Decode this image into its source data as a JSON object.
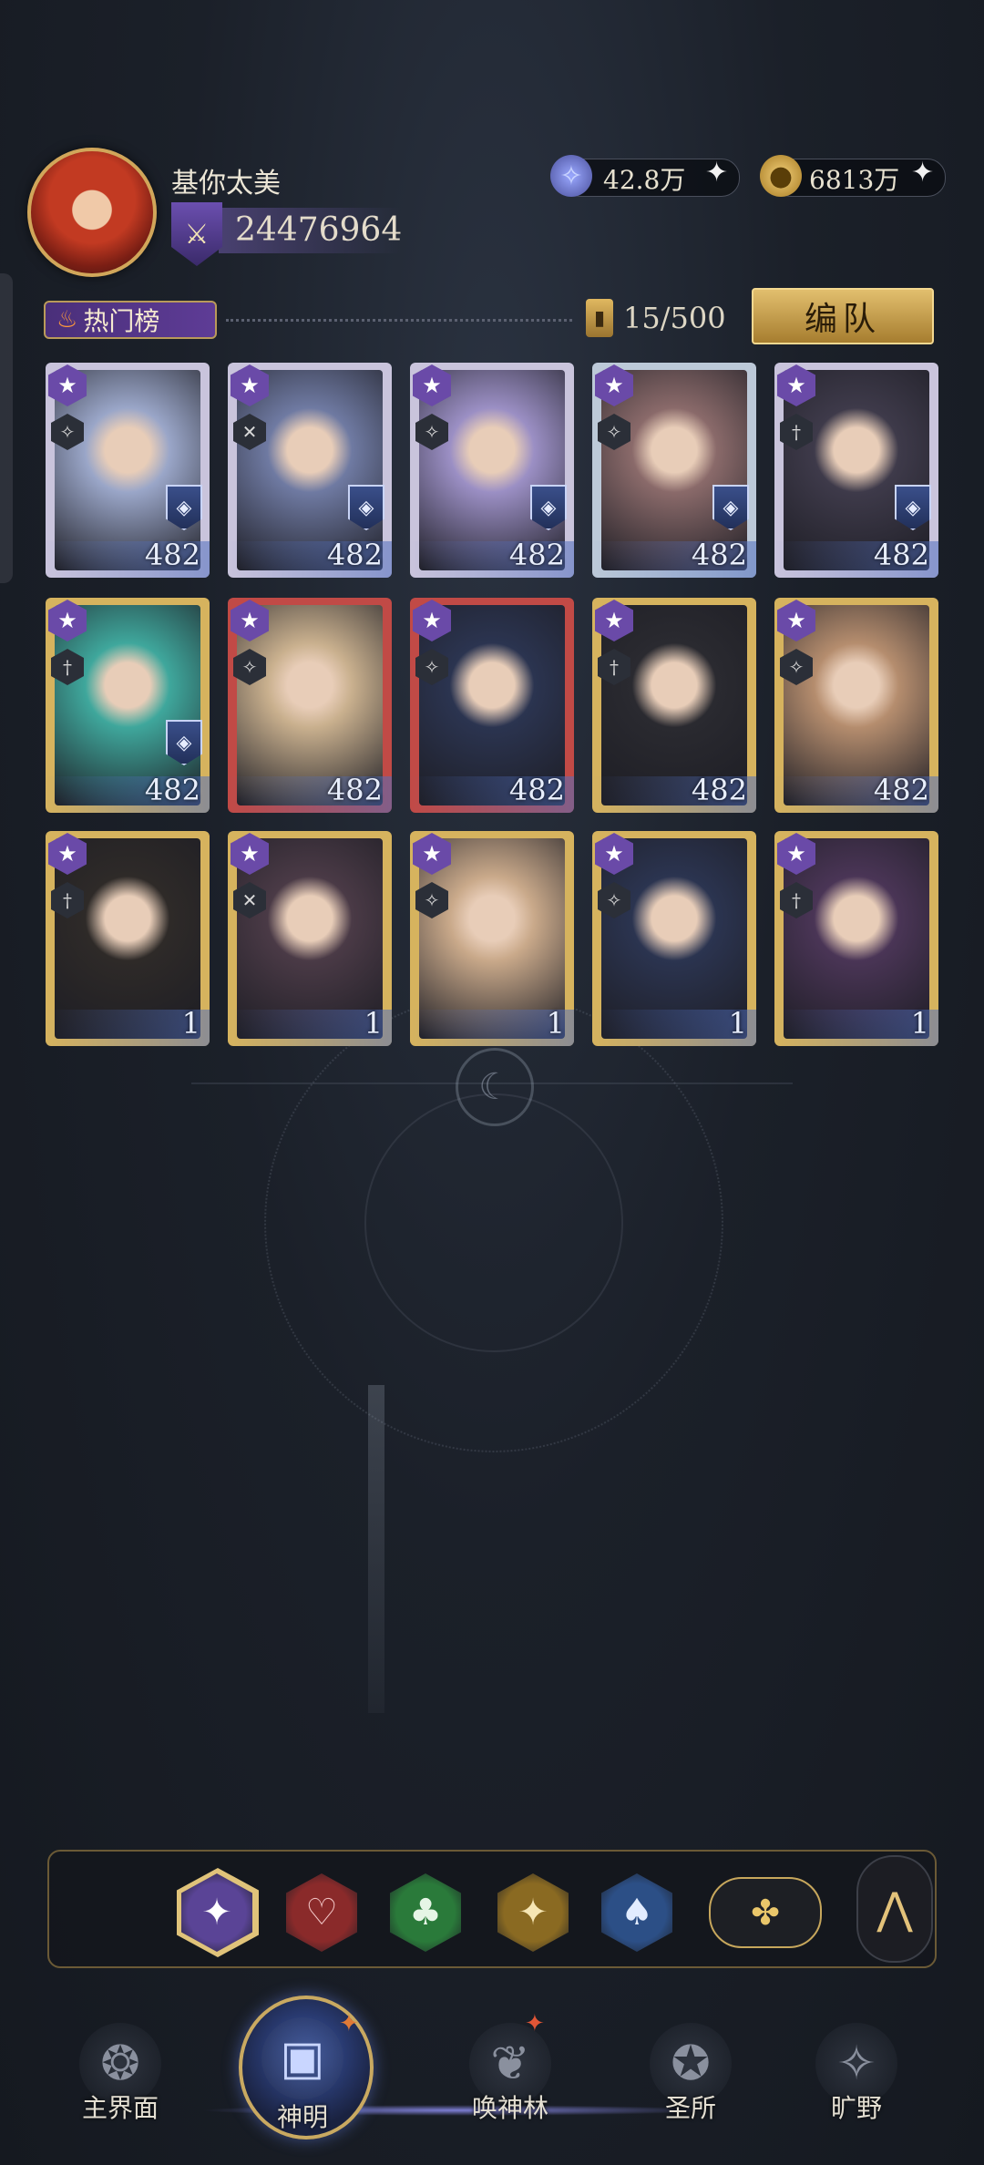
{
  "player": {
    "name": "基你太美",
    "power": "24476964",
    "power_badge_icon": "crossed-swords-icon"
  },
  "resources": [
    {
      "name": "crystal",
      "icon": "crystal-icon",
      "value": "42.8万"
    },
    {
      "name": "gold-coin",
      "icon": "gold-coin-icon",
      "value": "6813万"
    }
  ],
  "ranking": {
    "tab_label": "热门榜",
    "count": "15/500",
    "team_button": "编队"
  },
  "cards": [
    {
      "level": "482",
      "frame": "#c9c4dc",
      "face": "#9aa6c8",
      "emblem": "◈"
    },
    {
      "level": "482",
      "frame": "#c9c4dc",
      "face": "#6f7aa2",
      "emblem": "◈"
    },
    {
      "level": "482",
      "frame": "#c9c4dc",
      "face": "#9b8fc4",
      "emblem": "◈"
    },
    {
      "level": "482",
      "frame": "#bcc9d8",
      "face": "#8a6a6a",
      "emblem": "◈"
    },
    {
      "level": "482",
      "frame": "#c9c4dc",
      "face": "#3e3a4a",
      "emblem": "◈"
    },
    {
      "level": "482",
      "frame": "#d6b35e",
      "face": "#3fa79c",
      "emblem": "◈"
    },
    {
      "level": "482",
      "frame": "#c14a46",
      "face": "#c9b08e",
      "emblem": ""
    },
    {
      "level": "482",
      "frame": "#c14a46",
      "face": "#2b3450",
      "emblem": ""
    },
    {
      "level": "482",
      "frame": "#d6b35e",
      "face": "#2a2a30",
      "emblem": ""
    },
    {
      "level": "482",
      "frame": "#d6b35e",
      "face": "#b58d6e",
      "emblem": ""
    },
    {
      "level": "1",
      "frame": "#d6b35e",
      "face": "#2e2a28",
      "emblem": ""
    },
    {
      "level": "1",
      "frame": "#d6b35e",
      "face": "#4a3a46",
      "emblem": ""
    },
    {
      "level": "1",
      "frame": "#d6b35e",
      "face": "#c9a98a",
      "emblem": ""
    },
    {
      "level": "1",
      "frame": "#d6b35e",
      "face": "#2b3450",
      "emblem": ""
    },
    {
      "level": "1",
      "frame": "#d6b35e",
      "face": "#4a3556",
      "emblem": ""
    }
  ],
  "filters": [
    {
      "name": "all",
      "icon": "star-icon",
      "glyph": "✦",
      "color": "#5a4496",
      "text": "#ffffff"
    },
    {
      "name": "heart",
      "icon": "heart-icon",
      "glyph": "♡",
      "color": "#8a2a2a",
      "text": "#f3c7c7"
    },
    {
      "name": "club",
      "icon": "club-icon",
      "glyph": "♣",
      "color": "#2a7a3a",
      "text": "#e6f5e6"
    },
    {
      "name": "diamond",
      "icon": "diamond-star-icon",
      "glyph": "✦",
      "color": "#8a6a22",
      "text": "#f6e6b4"
    },
    {
      "name": "spade",
      "icon": "spade-icon",
      "glyph": "♠",
      "color": "#2c4f86",
      "text": "#e2ecff"
    }
  ],
  "nav": [
    {
      "label": "主界面",
      "icon": "home-emblem-icon"
    },
    {
      "label": "神明",
      "icon": "god-card-icon"
    },
    {
      "label": "唤神林",
      "icon": "tree-icon"
    },
    {
      "label": "圣所",
      "icon": "sanctuary-icon"
    },
    {
      "label": "旷野",
      "icon": "compass-icon"
    }
  ]
}
